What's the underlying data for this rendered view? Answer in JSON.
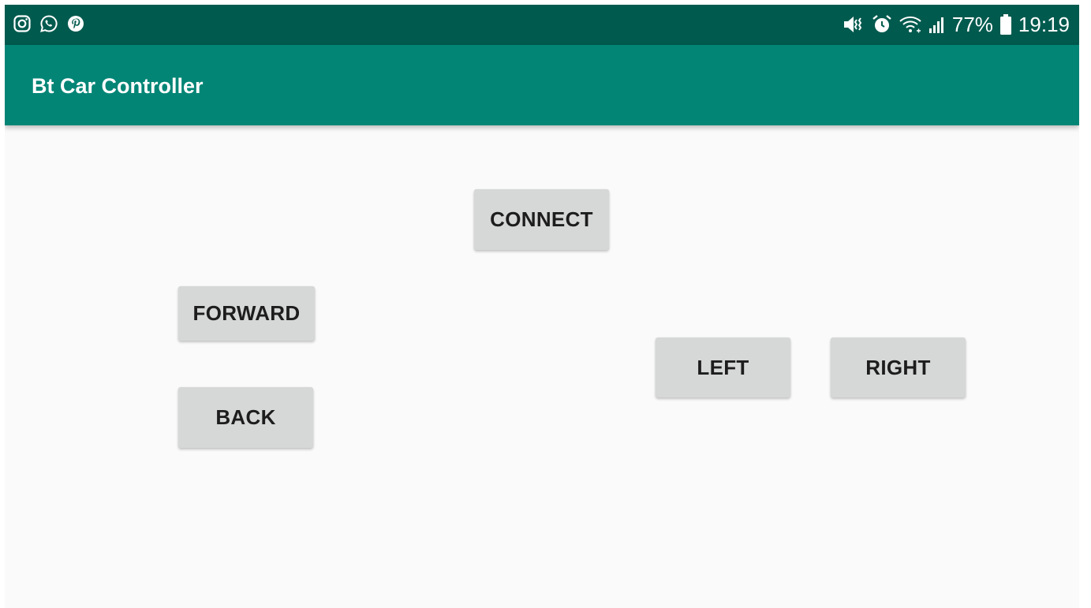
{
  "status_bar": {
    "left_icons": [
      "instagram-icon",
      "whatsapp-icon",
      "pinterest-icon"
    ],
    "right_icons": [
      "mute-vibrate-icon",
      "alarm-icon",
      "wifi-icon",
      "signal-icon",
      "battery-icon"
    ],
    "battery": "77%",
    "time": "19:19"
  },
  "app_bar": {
    "title": "Bt Car Controller"
  },
  "buttons": {
    "connect": "CONNECT",
    "forward": "FORWARD",
    "back": "BACK",
    "left": "LEFT",
    "right": "RIGHT"
  },
  "colors": {
    "status_bar": "#015a4e",
    "app_bar": "#038576",
    "background": "#fafafa",
    "button": "#d6d7d7",
    "button_text": "#1d1d1d"
  }
}
